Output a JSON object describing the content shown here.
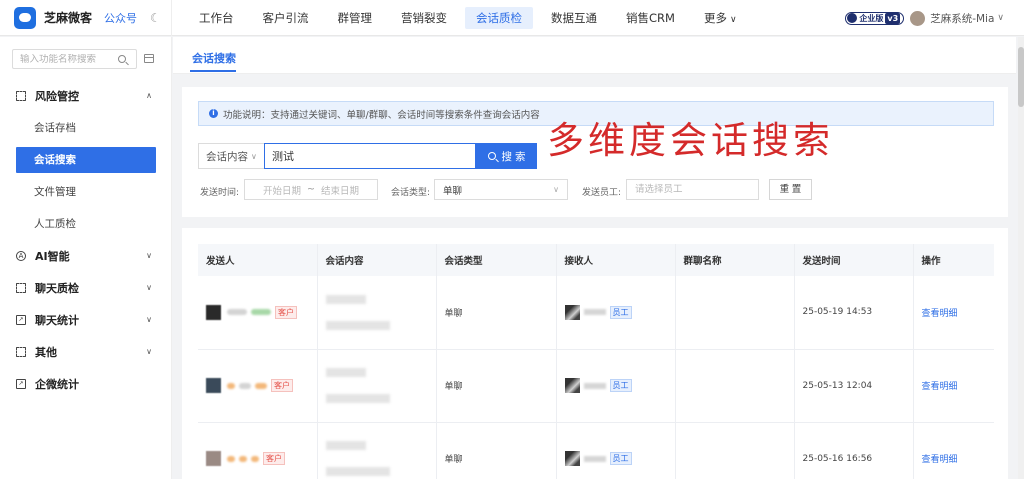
{
  "brand": {
    "name": "芝麻微客",
    "sub": "公众号"
  },
  "nav": [
    {
      "label": "工作台"
    },
    {
      "label": "客户引流"
    },
    {
      "label": "群管理"
    },
    {
      "label": "营销裂变"
    },
    {
      "label": "会话质检",
      "active": true
    },
    {
      "label": "数据互通"
    },
    {
      "label": "销售CRM"
    },
    {
      "label": "更多"
    }
  ],
  "topright": {
    "edition": "企业版",
    "version": "v3",
    "user": "芝麻系统-Mia"
  },
  "sidebar": {
    "search_placeholder": "输入功能名称搜索",
    "groups": [
      {
        "label": "风险管控",
        "icon": "frame-icon",
        "expanded": true,
        "items": [
          {
            "label": "会话存档"
          },
          {
            "label": "会话搜索",
            "active": true
          },
          {
            "label": "文件管理"
          },
          {
            "label": "人工质检"
          }
        ]
      },
      {
        "label": "AI智能",
        "icon": "ai-icon"
      },
      {
        "label": "聊天质检",
        "icon": "frame-icon"
      },
      {
        "label": "聊天统计",
        "icon": "stats-icon"
      },
      {
        "label": "其他",
        "icon": "frame-icon"
      },
      {
        "label": "企微统计",
        "icon": "stats-icon"
      }
    ]
  },
  "tabs": {
    "active": "会话搜索"
  },
  "filter": {
    "info": "功能说明：支持通过关键词、单聊/群聊、会话时间等搜索条件查询会话内容",
    "type_select": "会话内容",
    "keyword": "测试",
    "search_btn": "搜 索",
    "overlay": "多维度会话搜索",
    "send_time_label": "发送时间:",
    "start_placeholder": "开始日期",
    "date_sep": "~",
    "end_placeholder": "结束日期",
    "chat_type_label": "会话类型:",
    "chat_type_value": "单聊",
    "employee_label": "发送员工:",
    "employee_placeholder": "请选择员工",
    "reset_btn": "重 置"
  },
  "table": {
    "headers": [
      "发送人",
      "会话内容",
      "会话类型",
      "接收人",
      "群聊名称",
      "发送时间",
      "操作"
    ],
    "rows": [
      {
        "sender_tag": "客户",
        "type": "单聊",
        "receiver_tag": "员工",
        "time": "25-05-19 14:53",
        "action": "查看明细"
      },
      {
        "sender_tag": "客户",
        "type": "单聊",
        "receiver_tag": "员工",
        "time": "25-05-13 12:04",
        "action": "查看明细"
      },
      {
        "sender_tag": "客户",
        "type": "单聊",
        "receiver_tag": "员工",
        "time": "25-05-16 16:56",
        "action": "查看明细"
      }
    ]
  },
  "colors": {
    "accent": "#2f6fe6",
    "overlay_red": "#d42a2a"
  }
}
